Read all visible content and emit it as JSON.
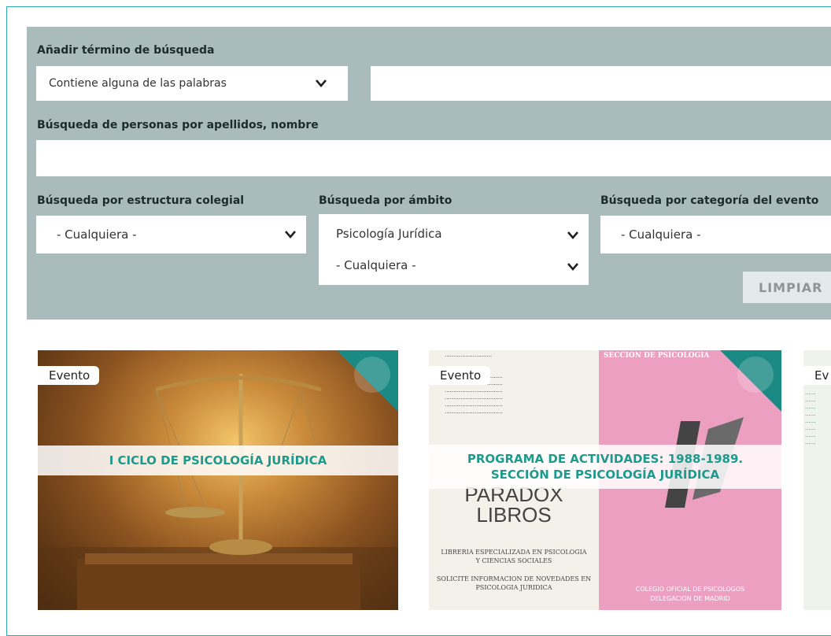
{
  "search": {
    "term_label": "Añadir término de búsqueda",
    "match_mode": "Contiene alguna de las palabras",
    "term_value": "",
    "persons_label": "Búsqueda de personas por apellidos, nombre",
    "persons_value": "",
    "structure_label": "Búsqueda por estructura colegial",
    "structure_value": "- Cualquiera -",
    "scope_label": "Búsqueda por ámbito",
    "scope_value": "Psicología Jurídica",
    "scope_sub_value": "- Cualquiera -",
    "category_label": "Búsqueda por categoría del evento",
    "category_value": "- Cualquiera -",
    "clear_label": "LIMPIAR"
  },
  "cards": [
    {
      "badge": "Evento",
      "title": "I CICLO DE PSICOLOGÍA JURÍDICA"
    },
    {
      "badge": "Evento",
      "title_line1": "PROGRAMA DE ACTIVIDADES: 1988-1989.",
      "title_line2": "SECCIÓN DE PSICOLOGÍA JURÍDICA",
      "doc_header": "SECCION DE PSICOLOGIA",
      "doc_logo_line1": "PARADOX",
      "doc_logo_line2": "LIBROS",
      "doc_sub1": "LIBRERIA ESPECIALIZADA EN PSICOLOGIA",
      "doc_sub2": "Y CIENCIAS SOCIALES",
      "doc_sub3": "SOLICITE INFORMACION DE NOVEDADES EN",
      "doc_sub4": "PSICOLOGIA JURIDICA",
      "doc_footer1": "COLEGIO OFICIAL DE PSICOLOGOS",
      "doc_footer2": "DELEGACION DE MADRID"
    },
    {
      "badge": "Ev"
    }
  ],
  "colors": {
    "panel": "#a9bcbb",
    "accent": "#1b9a8d",
    "corner": "#1b8a84"
  }
}
